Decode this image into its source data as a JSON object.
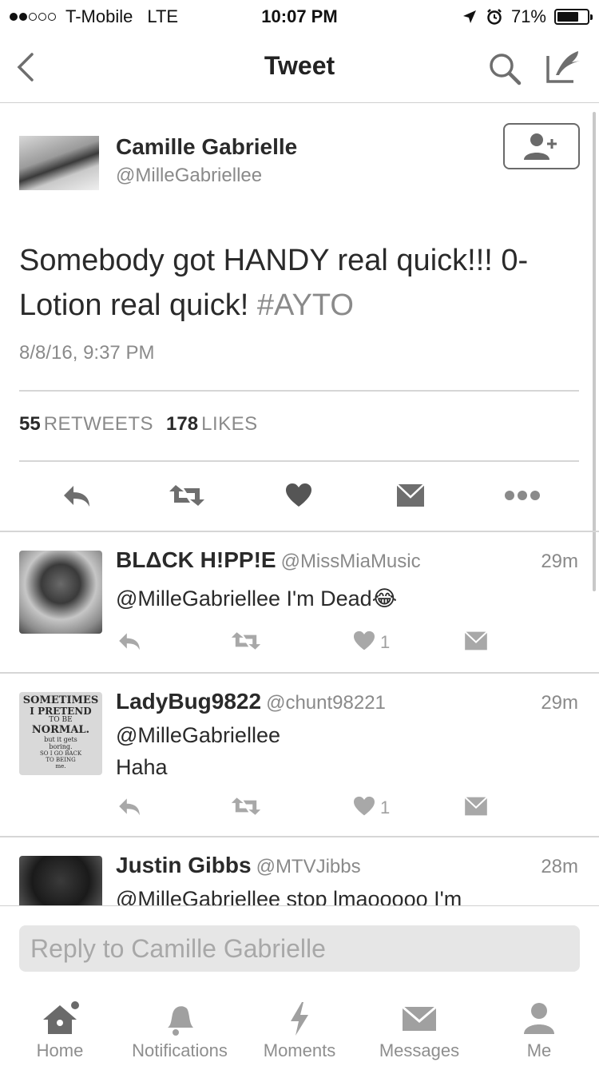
{
  "status_bar": {
    "carrier": "T-Mobile",
    "network": "LTE",
    "time": "10:07 PM",
    "battery": "71%",
    "battery_level": 0.71,
    "signal_bars_filled": 2,
    "signal_bars_total": 5
  },
  "nav": {
    "title": "Tweet",
    "back_icon": "chevron-left-icon",
    "search_icon": "search-icon",
    "compose_icon": "compose-icon"
  },
  "tweet": {
    "author_name": "Camille Gabrielle",
    "author_handle": "@MilleGabriellee",
    "text": "Somebody got HANDY real quick!!! 0-Lotion real quick! ",
    "hashtag": "#AYTO",
    "timestamp": "8/8/16, 9:37 PM",
    "retweets_count": "55",
    "retweets_label": "RETWEETS",
    "likes_count": "178",
    "likes_label": "LIKES"
  },
  "replies": [
    {
      "name": "BLΔCK H!PP!E",
      "handle": "@MissMiaMusic",
      "time": "29m",
      "text": "@MilleGabriellee I'm Dead😂",
      "likes": "1"
    },
    {
      "name": "LadyBug9822",
      "handle": "@chunt98221",
      "time": "29m",
      "text_line1": "@MilleGabriellee",
      "text_line2": "Haha",
      "likes": "1",
      "avatar_text": [
        "SOMETIMES",
        "I PRETEND",
        "TO BE",
        "NORMAL.",
        "but it gets",
        "boring.",
        "SO I GO BACK",
        "TO BEING",
        "me."
      ]
    },
    {
      "name": "Justin Gibbs",
      "handle": "@MTVJibbs",
      "time": "28m",
      "text": "@MilleGabriellee stop lmaooooo I'm"
    }
  ],
  "reply_box": {
    "placeholder": "Reply to Camille Gabrielle"
  },
  "tabs": [
    {
      "label": "Home",
      "icon": "home-icon"
    },
    {
      "label": "Notifications",
      "icon": "bell-icon"
    },
    {
      "label": "Moments",
      "icon": "lightning-icon"
    },
    {
      "label": "Messages",
      "icon": "envelope-icon"
    },
    {
      "label": "Me",
      "icon": "person-icon"
    }
  ]
}
